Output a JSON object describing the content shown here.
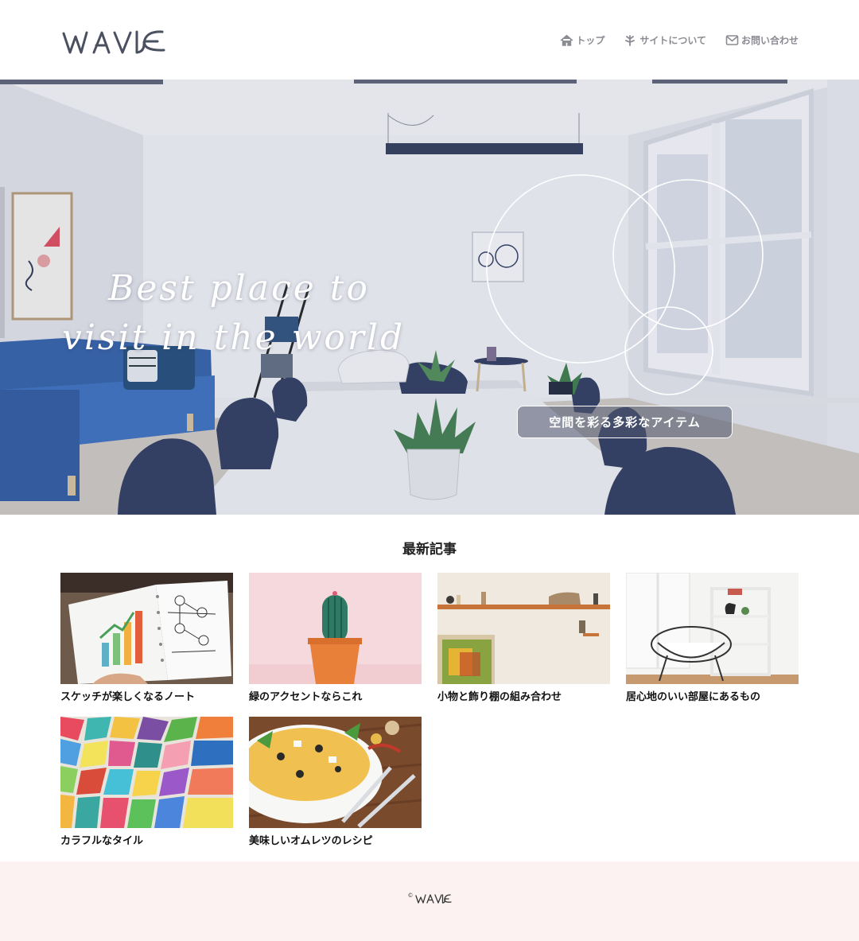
{
  "header": {
    "logo_text": "WAVE",
    "nav": [
      {
        "label": "トップ",
        "icon": "home-icon"
      },
      {
        "label": "サイトについて",
        "icon": "leaf-icon"
      },
      {
        "label": "お問い合わせ",
        "icon": "envelope-icon"
      }
    ]
  },
  "hero": {
    "title_line1": "Best place to",
    "title_line2": "visit in the world",
    "button_label": "空間を彩る多彩なアイテム"
  },
  "latest": {
    "heading": "最新記事",
    "articles": [
      {
        "title": "スケッチが楽しくなるノート",
        "image": "notebook-sketch-image"
      },
      {
        "title": "緑のアクセントならこれ",
        "image": "cactus-pot-image"
      },
      {
        "title": "小物と飾り棚の組み合わせ",
        "image": "wall-shelf-image"
      },
      {
        "title": "居心地のいい部屋にあるもの",
        "image": "chair-room-image"
      },
      {
        "title": "カラフルなタイル",
        "image": "colorful-tiles-image"
      },
      {
        "title": "美味しいオムレツのレシピ",
        "image": "omelette-plate-image"
      }
    ]
  },
  "footer": {
    "copyright_symbol": "©",
    "brand": "WAVE"
  },
  "colors": {
    "nav_text": "#8b8b93",
    "footer_bg": "#fcf2f1",
    "sofa_blue": "#2f5fa8",
    "chair_navy": "#2c3a5e"
  }
}
